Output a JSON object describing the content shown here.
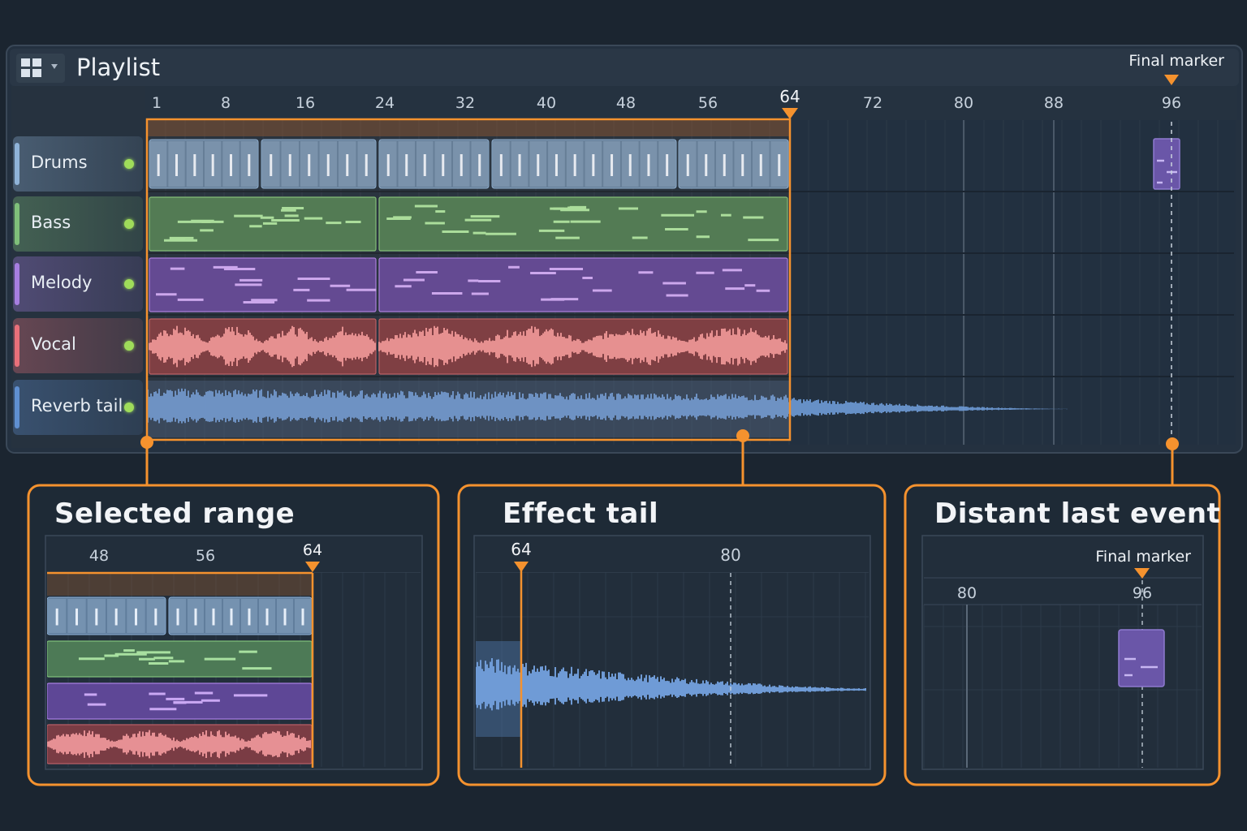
{
  "window": {
    "title": "Playlist",
    "final_marker_label": "Final marker",
    "ruler_labels": [
      "1",
      "8",
      "16",
      "24",
      "32",
      "40",
      "48",
      "56",
      "64",
      "72",
      "80",
      "88",
      "96"
    ]
  },
  "tracks": [
    {
      "name": "Drums",
      "color": "#8fb3d8",
      "active": true
    },
    {
      "name": "Bass",
      "color": "#7fbf7a",
      "active": true
    },
    {
      "name": "Melody",
      "color": "#a67ee0",
      "active": true
    },
    {
      "name": "Vocal",
      "color": "#e8707a",
      "active": true
    },
    {
      "name": "Reverb tail",
      "color": "#5f8fd0",
      "active": true
    }
  ],
  "selection": {
    "end_bar_label": "64",
    "color": "#f5922e"
  },
  "callouts": {
    "selected_range": {
      "title": "Selected range",
      "ruler": [
        "48",
        "56",
        "64"
      ]
    },
    "effect_tail": {
      "title": "Effect tail",
      "ruler": [
        "64",
        "80"
      ]
    },
    "distant_last_event": {
      "title": "Distant last event",
      "marker_label": "Final marker",
      "ruler": [
        "80",
        "96"
      ]
    }
  },
  "icons": {
    "menu": "grid-menu-icon",
    "dropdown": "chevron-down-icon",
    "marker": "triangle-down-marker-icon"
  }
}
